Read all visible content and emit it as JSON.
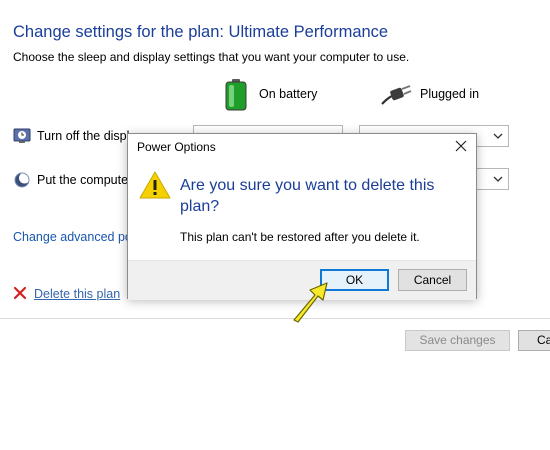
{
  "page": {
    "title": "Change settings for the plan: Ultimate Performance",
    "subtitle": "Choose the sleep and display settings that you want your computer to use.",
    "columns": {
      "battery": "On battery",
      "plugged": "Plugged in"
    },
    "rows": [
      {
        "label": "Turn off the displ"
      },
      {
        "label": "Put the computer"
      }
    ],
    "advanced_link": "Change advanced pov",
    "delete_link": "Delete this plan",
    "save_button": "Save changes",
    "cancel_button": "Ca"
  },
  "dialog": {
    "title": "Power Options",
    "heading": "Are you sure you want to delete this plan?",
    "message": "This plan can't be restored after you delete it.",
    "ok_button": "OK",
    "cancel_button": "Cancel"
  },
  "colors": {
    "heading_blue": "#1a3e99",
    "link_blue": "#1a56b0",
    "focus_blue": "#0f78d7",
    "warning_yellow": "#f5d100",
    "delete_red": "#d42020",
    "annotation_yellow": "#f7ea2a"
  },
  "icons": [
    "battery-icon",
    "plug-icon",
    "display-clock-icon",
    "moon-icon",
    "warning-icon",
    "close-icon",
    "delete-x-icon",
    "pointer-arrow-icon"
  ]
}
